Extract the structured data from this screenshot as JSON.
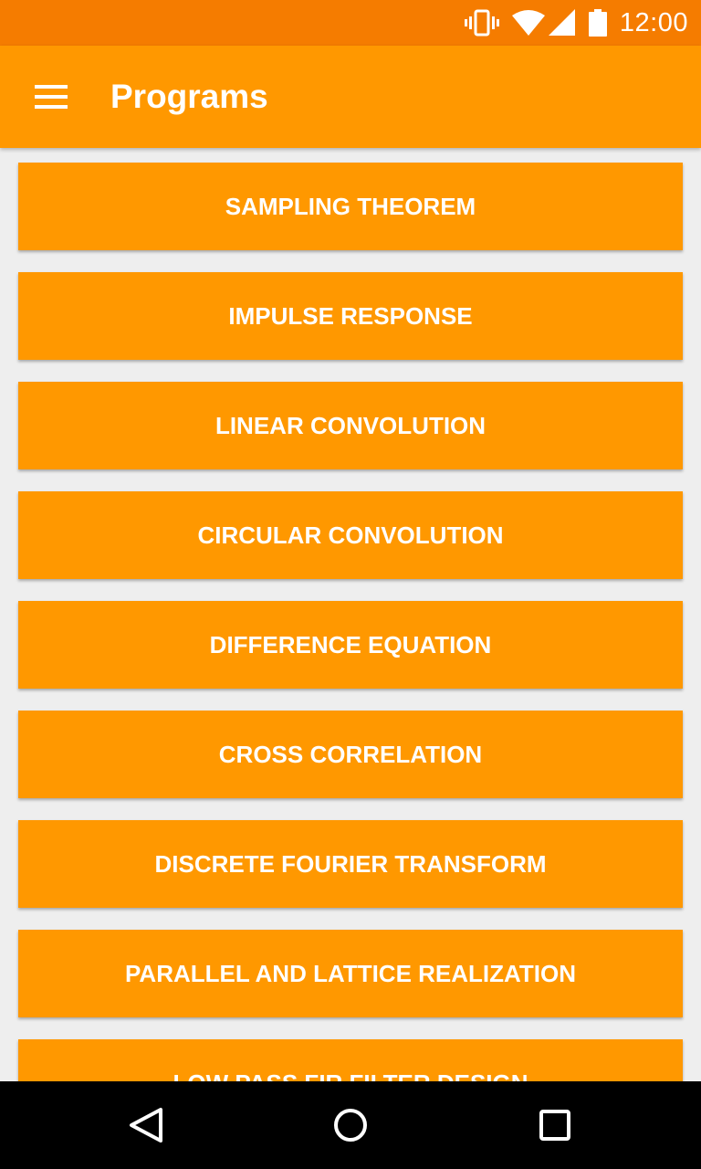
{
  "status_bar": {
    "time": "12:00",
    "icons": [
      "vibrate-icon",
      "wifi-icon",
      "cell-signal-icon",
      "battery-icon"
    ],
    "color": "#F57C00"
  },
  "app_bar": {
    "title": "Programs",
    "menu_icon": "hamburger-menu-icon",
    "color": "#FF9800"
  },
  "programs": [
    "SAMPLING THEOREM",
    "IMPULSE RESPONSE",
    "LINEAR CONVOLUTION",
    "CIRCULAR CONVOLUTION",
    "DIFFERENCE EQUATION",
    "CROSS CORRELATION",
    "DISCRETE FOURIER TRANSFORM",
    "PARALLEL AND LATTICE REALIZATION",
    "LOW PASS FIR FILTER DESIGN"
  ],
  "nav_bar": {
    "buttons": [
      "back-icon",
      "home-icon",
      "recents-icon"
    ]
  },
  "colors": {
    "accent": "#FF9800",
    "accent_dark": "#F57C00",
    "background": "#EEEEEE",
    "text_on_accent": "#FFFFFF"
  }
}
